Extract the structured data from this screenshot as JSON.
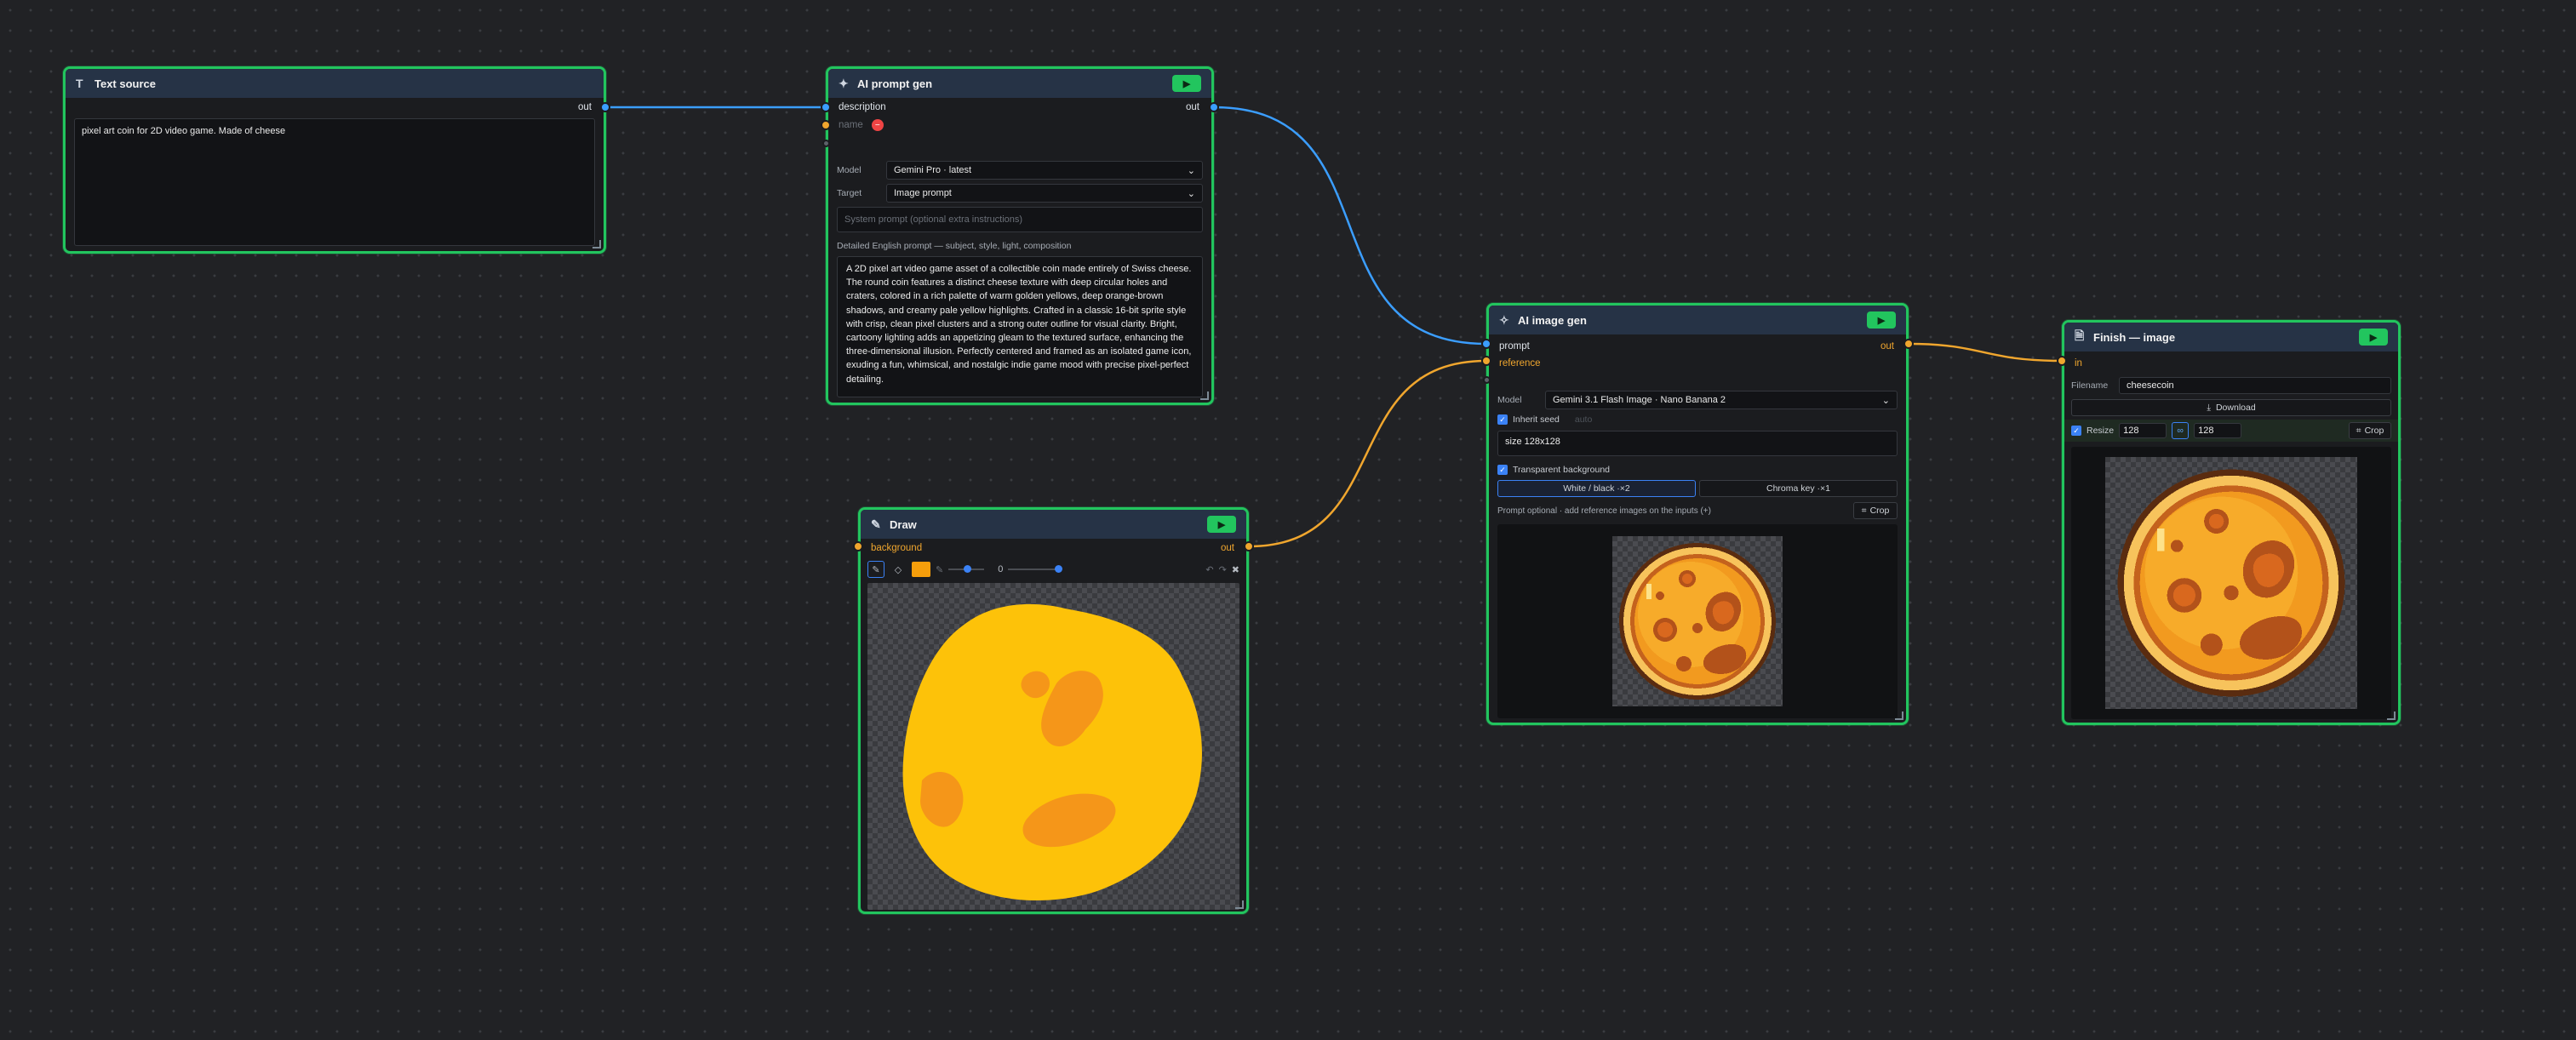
{
  "colors": {
    "accent": "#22c55e",
    "wire_text": "#3b9eff",
    "wire_image": "#f0a62e",
    "background": "#212225"
  },
  "text_source": {
    "title": "Text source",
    "icon": "text-icon",
    "out_label": "out",
    "value": "pixel art coin for 2D video game. Made of cheese"
  },
  "prompt_gen": {
    "title": "AI prompt gen",
    "icon": "wand-icon",
    "input_description": "description",
    "input_name": "name",
    "out_label": "out",
    "model_label": "Model",
    "model_value": "Gemini Pro · latest",
    "target_label": "Target",
    "target_value": "Image prompt",
    "system_placeholder": "System prompt (optional extra instructions)",
    "section_label": "Detailed English prompt — subject, style, light, composition",
    "prompt_text": "A 2D pixel art video game asset of a collectible coin made entirely of Swiss cheese. The round coin features a distinct cheese texture with deep circular holes and craters, colored in a rich palette of warm golden yellows, deep orange-brown shadows, and creamy pale yellow highlights. Crafted in a classic 16-bit sprite style with crisp, clean pixel clusters and a strong outer outline for visual clarity. Bright, cartoony lighting adds an appetizing gleam to the textured surface, enhancing the three-dimensional illusion. Perfectly centered and framed as an isolated game icon, exuding a fun, whimsical, and nostalgic indie game mood with precise pixel-perfect detailing."
  },
  "draw": {
    "title": "Draw",
    "icon": "pencil-icon",
    "input_background": "background",
    "out_label": "out",
    "brush_color": "#f59e0b",
    "opacity_value": "0"
  },
  "image_gen": {
    "title": "AI image gen",
    "icon": "image-gen-icon",
    "input_prompt": "prompt",
    "input_reference": "reference",
    "out_label": "out",
    "model_label": "Model",
    "model_value": "Gemini 3.1 Flash Image · Nano Banana 2",
    "inherit_seed_label": "Inherit seed",
    "seed_placeholder": "auto",
    "size_value": "size 128x128",
    "transparent_label": "Transparent background",
    "mode_white_black": "White / black ·×2",
    "mode_chroma": "Chroma key ·×1",
    "hint_text": "Prompt optional · add reference images on the inputs (+)",
    "crop_label": "Crop"
  },
  "finish": {
    "title": "Finish — image",
    "icon": "file-icon",
    "input_in": "in",
    "filename_label": "Filename",
    "filename_value": "cheesecoin",
    "download_label": "Download",
    "resize_label": "Resize",
    "width_value": "128",
    "height_value": "128",
    "crop_label": "Crop"
  }
}
